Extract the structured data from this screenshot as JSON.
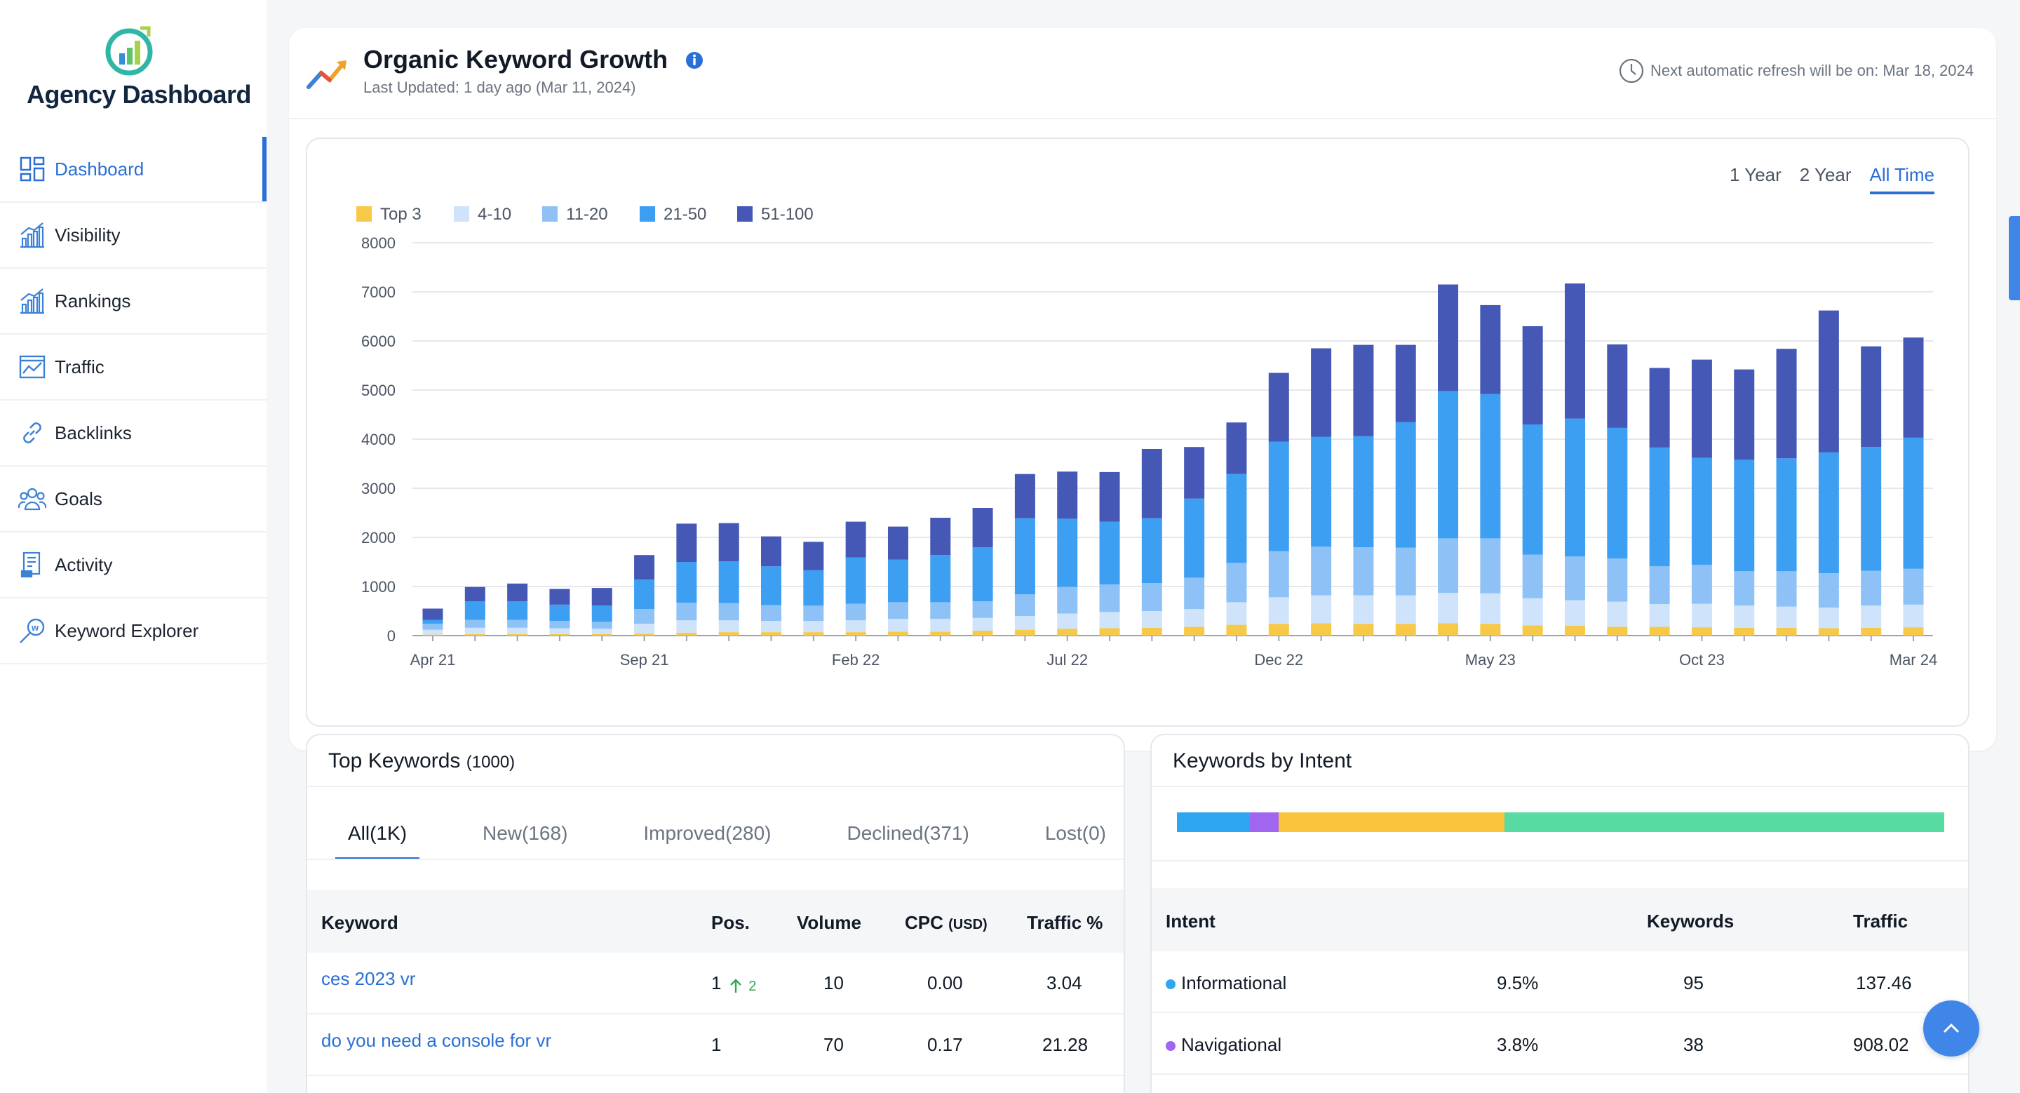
{
  "app": {
    "name": "Agency Dashboard"
  },
  "sidebar": {
    "items": [
      {
        "label": "Dashboard",
        "icon": "dashboard-icon",
        "active": true
      },
      {
        "label": "Visibility",
        "icon": "visibility-chart-icon"
      },
      {
        "label": "Rankings",
        "icon": "rankings-chart-icon"
      },
      {
        "label": "Traffic",
        "icon": "traffic-chart-icon"
      },
      {
        "label": "Backlinks",
        "icon": "link-icon"
      },
      {
        "label": "Goals",
        "icon": "users-icon"
      },
      {
        "label": "Activity",
        "icon": "document-icon"
      },
      {
        "label": "Keyword Explorer",
        "icon": "keyword-search-icon"
      }
    ]
  },
  "header": {
    "title": "Organic Keyword Growth",
    "subtitle": "Last Updated: 1 day ago (Mar 11, 2024)",
    "refresh_text": "Next automatic refresh will be on: Mar 18, 2024"
  },
  "range_tabs": {
    "one_year": "1 Year",
    "two_year": "2 Year",
    "all_time": "All Time",
    "active": "All Time"
  },
  "colors": {
    "top3": "#f7c948",
    "r4_10": "#cfe4fb",
    "r11_20": "#8ec2f7",
    "r21_50": "#3d9ff2",
    "r51_100": "#4558b6",
    "accent": "#2a6fd6"
  },
  "chart_data": {
    "type": "bar",
    "stacked": true,
    "title": "",
    "xlabel": "",
    "ylabel": "",
    "ylim": [
      0,
      8000
    ],
    "yticks": [
      0,
      1000,
      2000,
      3000,
      4000,
      5000,
      6000,
      7000,
      8000
    ],
    "grid": true,
    "legend_position": "top-left",
    "x_tick_labels": [
      {
        "index": 0,
        "label": "Apr 21"
      },
      {
        "index": 5,
        "label": "Sep 21"
      },
      {
        "index": 10,
        "label": "Feb 22"
      },
      {
        "index": 15,
        "label": "Jul 22"
      },
      {
        "index": 20,
        "label": "Dec 22"
      },
      {
        "index": 25,
        "label": "May 23"
      },
      {
        "index": 30,
        "label": "Oct 23"
      },
      {
        "index": 35,
        "label": "Mar 24"
      }
    ],
    "categories": [
      "Apr 21",
      "May 21",
      "Jun 21",
      "Jul 21",
      "Aug 21",
      "Sep 21",
      "Oct 21",
      "Nov 21",
      "Dec 21",
      "Jan 22",
      "Feb 22",
      "Mar 22",
      "Apr 22",
      "May 22",
      "Jun 22",
      "Jul 22",
      "Aug 22",
      "Sep 22",
      "Oct 22",
      "Nov 22",
      "Dec 22",
      "Jan 23",
      "Feb 23",
      "Mar 23",
      "Apr 23",
      "May 23",
      "Jun 23",
      "Jul 23",
      "Aug 23",
      "Sep 23",
      "Oct 23",
      "Nov 23",
      "Dec 23",
      "Jan 24",
      "Feb 24",
      "Mar 24"
    ],
    "series": [
      {
        "name": "Top 3",
        "values": [
          20,
          30,
          30,
          30,
          30,
          40,
          60,
          70,
          70,
          70,
          70,
          80,
          80,
          100,
          120,
          140,
          150,
          160,
          180,
          220,
          240,
          250,
          240,
          240,
          250,
          240,
          210,
          200,
          180,
          180,
          170,
          160,
          160,
          150,
          160,
          170
        ]
      },
      {
        "name": "4-10",
        "values": [
          100,
          130,
          130,
          120,
          110,
          200,
          250,
          240,
          230,
          230,
          240,
          260,
          260,
          260,
          280,
          310,
          330,
          340,
          360,
          460,
          540,
          570,
          580,
          580,
          620,
          620,
          550,
          520,
          510,
          460,
          480,
          450,
          430,
          420,
          450,
          460
        ]
      },
      {
        "name": "11-20",
        "values": [
          120,
          160,
          160,
          150,
          140,
          300,
          360,
          350,
          320,
          310,
          340,
          340,
          340,
          340,
          440,
          540,
          560,
          570,
          640,
          800,
          940,
          990,
          980,
          970,
          1110,
          1120,
          890,
          890,
          880,
          770,
          790,
          700,
          720,
          700,
          710,
          730
        ]
      },
      {
        "name": "21-50",
        "values": [
          80,
          380,
          380,
          330,
          330,
          600,
          830,
          850,
          790,
          720,
          940,
          870,
          960,
          1100,
          1550,
          1390,
          1280,
          1320,
          1610,
          1810,
          2230,
          2240,
          2260,
          2560,
          3000,
          2940,
          2650,
          2810,
          2660,
          2420,
          2180,
          2270,
          2300,
          2460,
          2520,
          2670
        ]
      },
      {
        "name": "51-100",
        "values": [
          230,
          290,
          360,
          320,
          360,
          500,
          780,
          780,
          610,
          580,
          730,
          670,
          760,
          800,
          900,
          960,
          1010,
          1410,
          1050,
          1050,
          1400,
          1800,
          1860,
          1570,
          2170,
          1810,
          2000,
          2750,
          1700,
          1620,
          2000,
          1840,
          2230,
          2890,
          2050,
          2040
        ]
      }
    ]
  },
  "top_keywords": {
    "title": "Top Keywords",
    "count": "(1000)",
    "tabs": [
      "All(1K)",
      "New(168)",
      "Improved(280)",
      "Declined(371)",
      "Lost(0)"
    ],
    "columns": {
      "keyword": "Keyword",
      "pos": "Pos.",
      "volume": "Volume",
      "cpc": "CPC",
      "cpc_unit": "(USD)",
      "traffic": "Traffic %"
    },
    "rows": [
      {
        "keyword": "ces 2023 vr",
        "pos": "1",
        "change": "2",
        "volume": "10",
        "cpc": "0.00",
        "traffic": "3.04"
      },
      {
        "keyword": "do you need a console for vr",
        "pos": "1",
        "change": "",
        "volume": "70",
        "cpc": "0.17",
        "traffic": "21.28"
      }
    ]
  },
  "intent": {
    "title": "Keywords by Intent",
    "bar": [
      {
        "name": "Informational",
        "percent": 9.5,
        "color": "#2ea7f0"
      },
      {
        "name": "Navigational",
        "percent": 3.8,
        "color": "#a066f0"
      },
      {
        "name": "Commercial",
        "percent": 29.4,
        "color": "#fbc43d"
      },
      {
        "name": "Transactional",
        "percent": 57.3,
        "color": "#57dba3"
      }
    ],
    "columns": {
      "intent": "Intent",
      "keywords": "Keywords",
      "traffic": "Traffic"
    },
    "rows": [
      {
        "name": "Informational",
        "percent": "9.5%",
        "keywords": "95",
        "traffic": "137.46",
        "color": "#2ea7f0"
      },
      {
        "name": "Navigational",
        "percent": "3.8%",
        "keywords": "38",
        "traffic": "908.02",
        "color": "#a066f0"
      }
    ]
  }
}
